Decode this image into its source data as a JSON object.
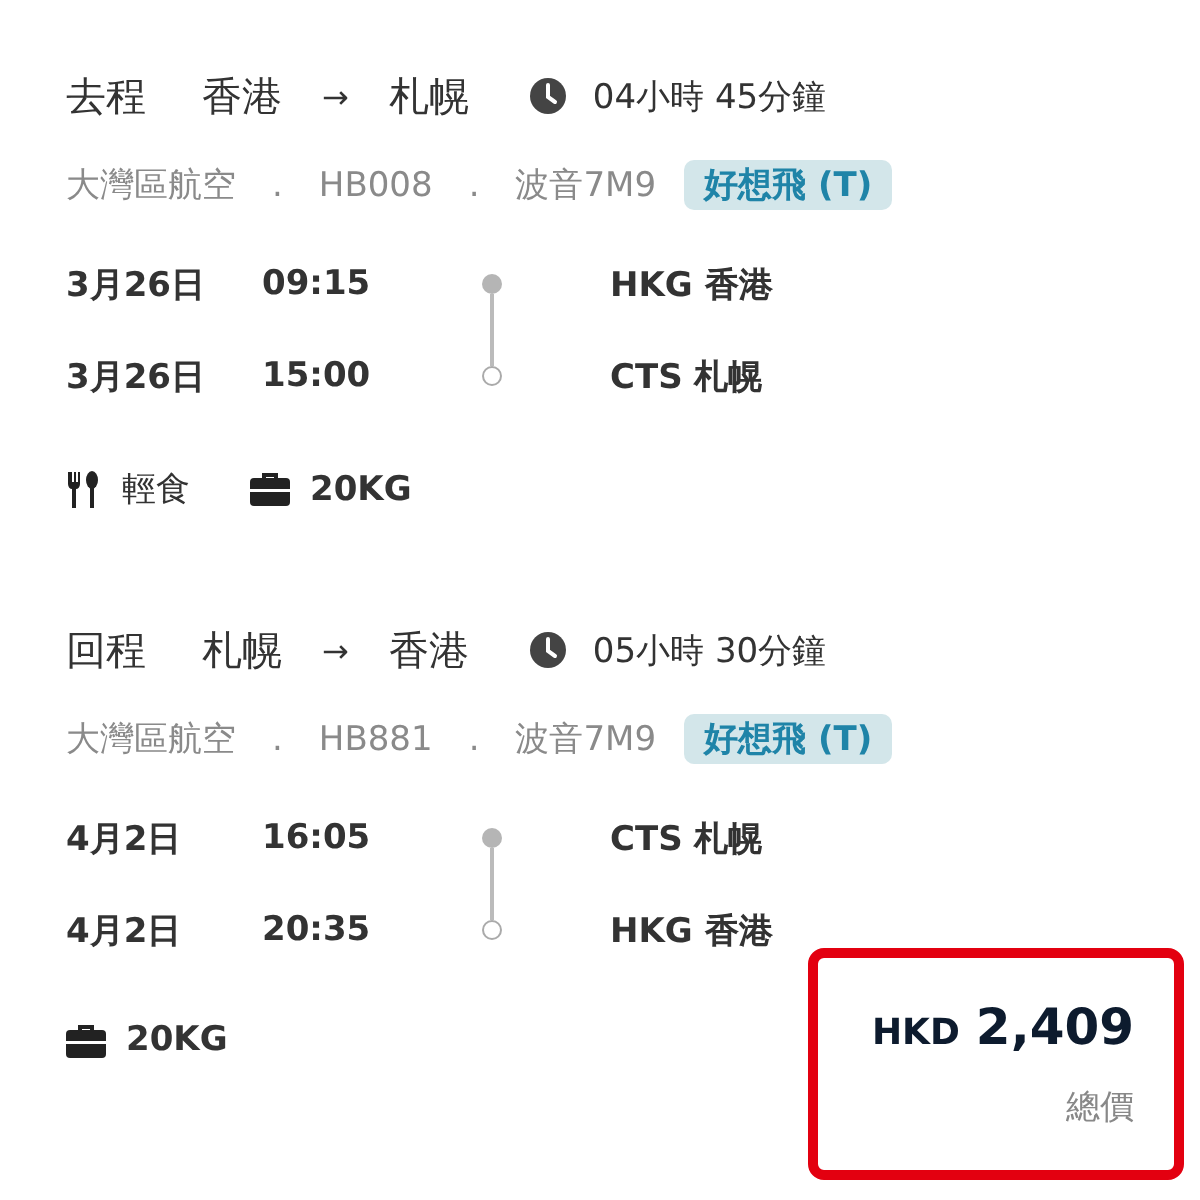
{
  "legs": [
    {
      "direction": "去程",
      "from": "香港",
      "arrow": "→",
      "to": "札幌",
      "duration": "04小時 45分鐘",
      "airline": "大灣區航空",
      "separator_1": ".",
      "flight": "HB008",
      "separator_2": ".",
      "aircraft": "波音7M9",
      "fare_tag": "好想飛 (T)",
      "stops": [
        {
          "date": "3月26日",
          "time": "09:15",
          "airport": "HKG 香港"
        },
        {
          "date": "3月26日",
          "time": "15:00",
          "airport": "CTS 札幌"
        }
      ],
      "amenities": [
        {
          "kind": "meal",
          "label": "輕食"
        },
        {
          "kind": "baggage",
          "label": "20KG"
        }
      ]
    },
    {
      "direction": "回程",
      "from": "札幌",
      "arrow": "→",
      "to": "香港",
      "duration": "05小時 30分鐘",
      "airline": "大灣區航空",
      "separator_1": ".",
      "flight": "HB881",
      "separator_2": ".",
      "aircraft": "波音7M9",
      "fare_tag": "好想飛 (T)",
      "stops": [
        {
          "date": "4月2日",
          "time": "16:05",
          "airport": "CTS 札幌"
        },
        {
          "date": "4月2日",
          "time": "20:35",
          "airport": "HKG 香港"
        }
      ],
      "amenities": [
        {
          "kind": "baggage",
          "label": "20KG"
        }
      ]
    }
  ],
  "price": {
    "currency": "HKD",
    "amount": "2,409",
    "label": "總價"
  }
}
